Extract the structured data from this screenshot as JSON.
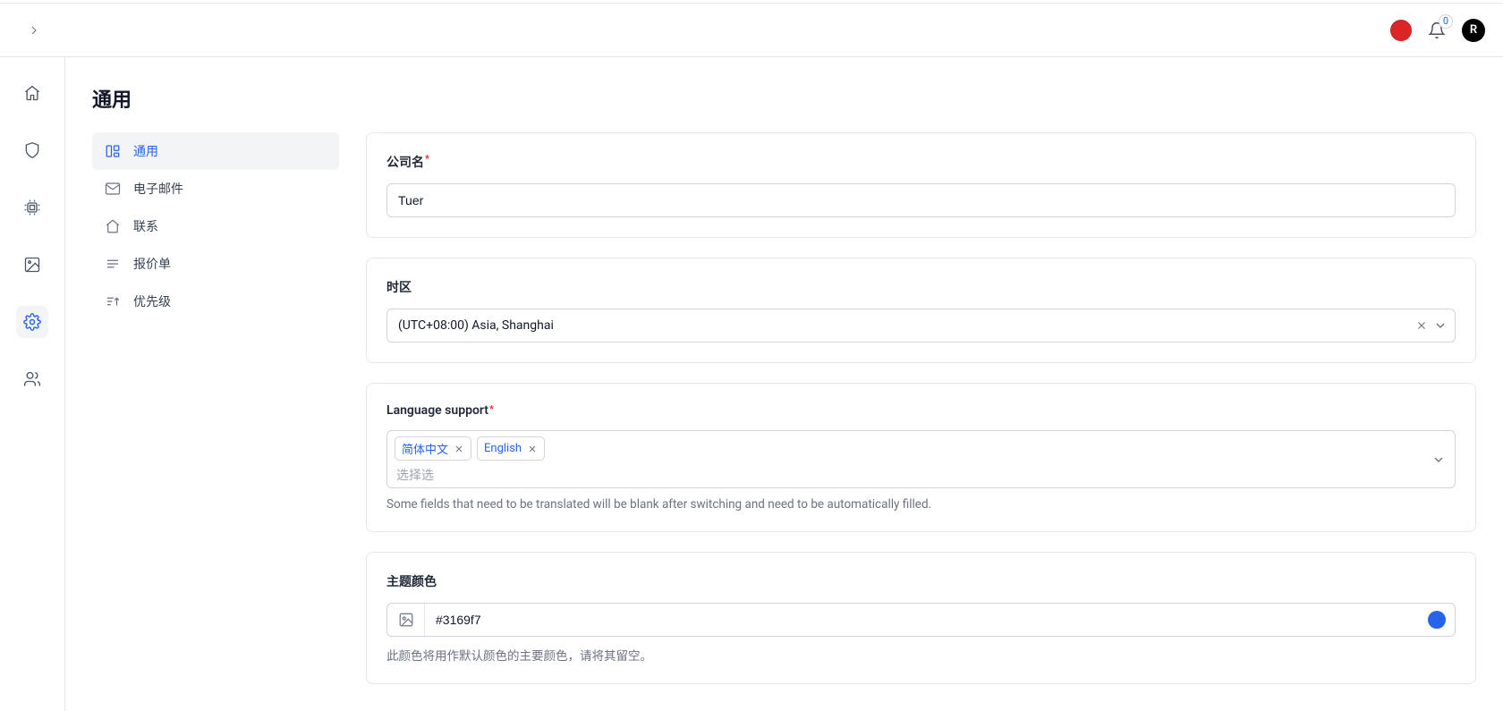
{
  "header": {
    "notification_count": "0",
    "avatar_initial": "R"
  },
  "page": {
    "title": "通用"
  },
  "side_tabs": {
    "general": "通用",
    "email": "电子邮件",
    "contact": "联系",
    "quotation": "报价单",
    "priority": "优先级"
  },
  "form": {
    "company": {
      "label": "公司名",
      "value": "Tuer"
    },
    "timezone": {
      "label": "时区",
      "value": "(UTC+08:00) Asia, Shanghai"
    },
    "language": {
      "label": "Language support",
      "tag1": "简体中文",
      "tag2": "English",
      "placeholder": "选择选",
      "help": "Some fields that need to be translated will be blank after switching and need to be automatically filled."
    },
    "theme": {
      "label": "主题颜色",
      "value": "#3169f7",
      "swatch_color": "#2563eb",
      "help": "此颜色将用作默认颜色的主要颜色，请将其留空。"
    }
  }
}
